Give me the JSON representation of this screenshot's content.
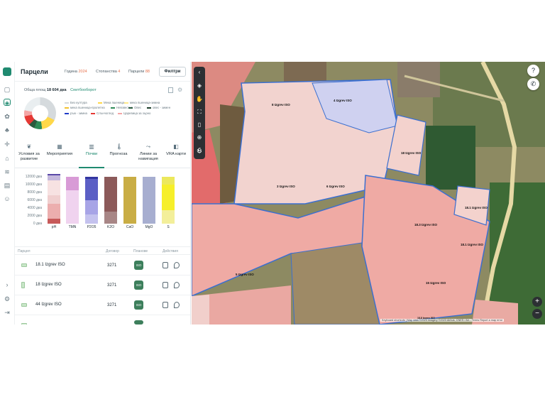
{
  "header": {
    "title": "Парцели",
    "year_label": "Година",
    "year": "2024",
    "farms_label": "Стопанства",
    "farms": "4",
    "parcels_label": "Парцели",
    "parcels": "88",
    "filters_button": "Филтри"
  },
  "summary": {
    "area_label": "Обща площ",
    "area_value": "18 604 дка",
    "crop_rotation_link": "Сеитбооборот"
  },
  "crops_legend": [
    {
      "label": "Без култура",
      "color": "#d5dadd"
    },
    {
      "label": "Мека пшеница",
      "color": "#ffd84a"
    },
    {
      "label": "мека пшеница-зимна",
      "color": "#ffe98a"
    },
    {
      "label": "мека пшеница-пролетна",
      "color": "#f2c230"
    },
    {
      "label": "Невзвестна",
      "color": "#2e8b57"
    },
    {
      "label": "Овес",
      "color": "#2a5b3e"
    },
    {
      "label": "овес - зимен",
      "color": "#1a3d28"
    },
    {
      "label": "ръж - зимна",
      "color": "#1e3cc8"
    },
    {
      "label": "Слънчоглед",
      "color": "#e53935"
    },
    {
      "label": "Царевица за зърно",
      "color": "#f4a6a6"
    }
  ],
  "tabs": [
    {
      "label": "Условия за развитие",
      "icon": "sprout-icon"
    },
    {
      "label": "Мероприятия",
      "icon": "calendar-icon"
    },
    {
      "label": "Почви",
      "icon": "soil-icon"
    },
    {
      "label": "Прогноза",
      "icon": "thermometer-icon"
    },
    {
      "label": "Линии за навигация",
      "icon": "route-icon"
    },
    {
      "label": "VRA карти",
      "icon": "layers-icon"
    }
  ],
  "chart_data": {
    "type": "bar",
    "title": "",
    "ylabel": "",
    "ylim": [
      0,
      13000
    ],
    "yticks": [
      "0 дка",
      "2000 дка",
      "4000 дка",
      "6000 дка",
      "8000 дка",
      "10000 дка",
      "12000 дка"
    ],
    "categories": [
      "pH",
      "TMN",
      "P2O5",
      "K2O",
      "CaO",
      "MgO",
      "S"
    ],
    "stacks": [
      [
        {
          "value": 1300,
          "color": "#c75a5a"
        },
        {
          "value": 3700,
          "color": "#ecaeae"
        },
        {
          "value": 2300,
          "color": "#f0cfcf"
        },
        {
          "value": 3700,
          "color": "#f7e2e2"
        },
        {
          "value": 1200,
          "color": "#c4b8dd"
        },
        {
          "value": 500,
          "color": "#5a4aa8"
        }
      ],
      [
        {
          "value": 8500,
          "color": "#f0d3ef"
        },
        {
          "value": 3500,
          "color": "#d89bd6"
        }
      ],
      [
        {
          "value": 2300,
          "color": "#c4c2ee"
        },
        {
          "value": 3700,
          "color": "#a7a4e6"
        },
        {
          "value": 5300,
          "color": "#5b5fc5"
        },
        {
          "value": 700,
          "color": "#3336a0"
        }
      ],
      [
        {
          "value": 3100,
          "color": "#a88686"
        },
        {
          "value": 8900,
          "color": "#8c5a5a"
        }
      ],
      [
        {
          "value": 12000,
          "color": "#c9ad45"
        }
      ],
      [
        {
          "value": 12000,
          "color": "#a7aed0"
        }
      ],
      [
        {
          "value": 3400,
          "color": "#f3ef9a"
        },
        {
          "value": 6600,
          "color": "#f6ef2a"
        },
        {
          "value": 2000,
          "color": "#ece85c"
        }
      ]
    ]
  },
  "table": {
    "columns": [
      "Парцел",
      "Договор",
      "Планове",
      "Действия"
    ],
    "rows": [
      {
        "name": "18.1 Izgrev ISO",
        "contract": "3271",
        "plan": "ISO"
      },
      {
        "name": "18 Izgrev ISO",
        "contract": "3271",
        "plan": "ISO"
      },
      {
        "name": "44 Izgrev ISO",
        "contract": "3271",
        "plan": "ISO"
      }
    ]
  },
  "map": {
    "labels": [
      "8 Izgrev ISO",
      "4 Izgrev ISO",
      "3 Izgrev ISO",
      "6 Izgrev ISO",
      "18 Izgrev ISO",
      "18.1 Izgrev ISO",
      "18.3 Izgrev ISO",
      "18.1 Izgrev ISO",
      "5 Izgrev ISO",
      "15 Izgrev ISO",
      "18.8 Izgrev ISO"
    ],
    "attribution": "Keyboard shortcuts | Map data ©2023 Imagery ©2023 Airbus, CNES / Air...  Terms  Report a map error"
  }
}
